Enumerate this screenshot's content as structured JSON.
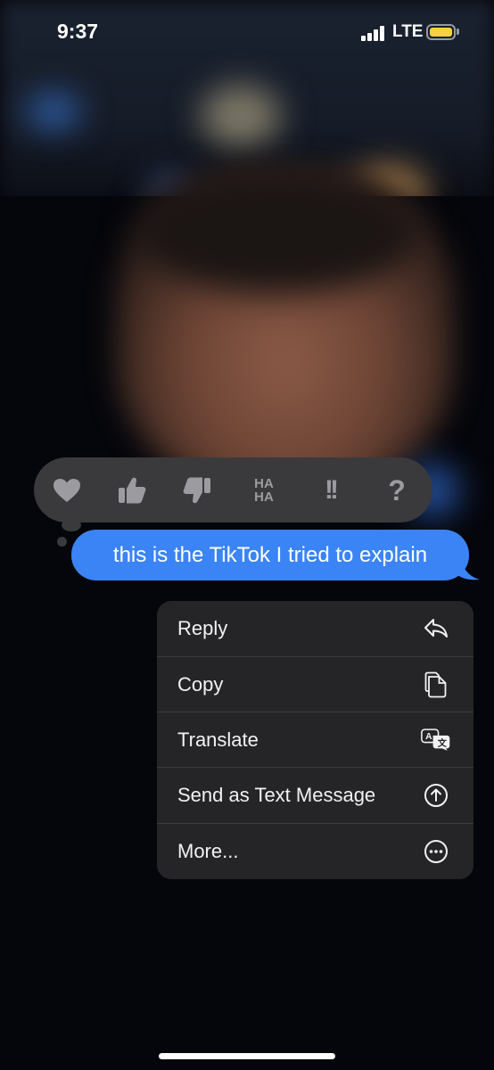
{
  "status_bar": {
    "time": "9:37",
    "network": "LTE",
    "battery_color": "#f6d23f"
  },
  "tapbacks": [
    {
      "name": "heart-icon"
    },
    {
      "name": "thumbs-up-icon"
    },
    {
      "name": "thumbs-down-icon"
    },
    {
      "name": "haha-icon",
      "line1": "HA",
      "line2": "HA"
    },
    {
      "name": "exclamation-icon",
      "text": "!!"
    },
    {
      "name": "question-icon",
      "text": "?"
    }
  ],
  "message": {
    "text": "this is the TikTok I tried to explain",
    "color": "#3b84f5"
  },
  "menu": {
    "items": [
      {
        "label": "Reply",
        "icon": "reply-arrow-icon"
      },
      {
        "label": "Copy",
        "icon": "copy-icon"
      },
      {
        "label": "Translate",
        "icon": "translate-icon"
      },
      {
        "label": "Send as Text Message",
        "icon": "arrow-up-circle-icon"
      },
      {
        "label": "More...",
        "icon": "ellipsis-circle-icon"
      }
    ]
  }
}
